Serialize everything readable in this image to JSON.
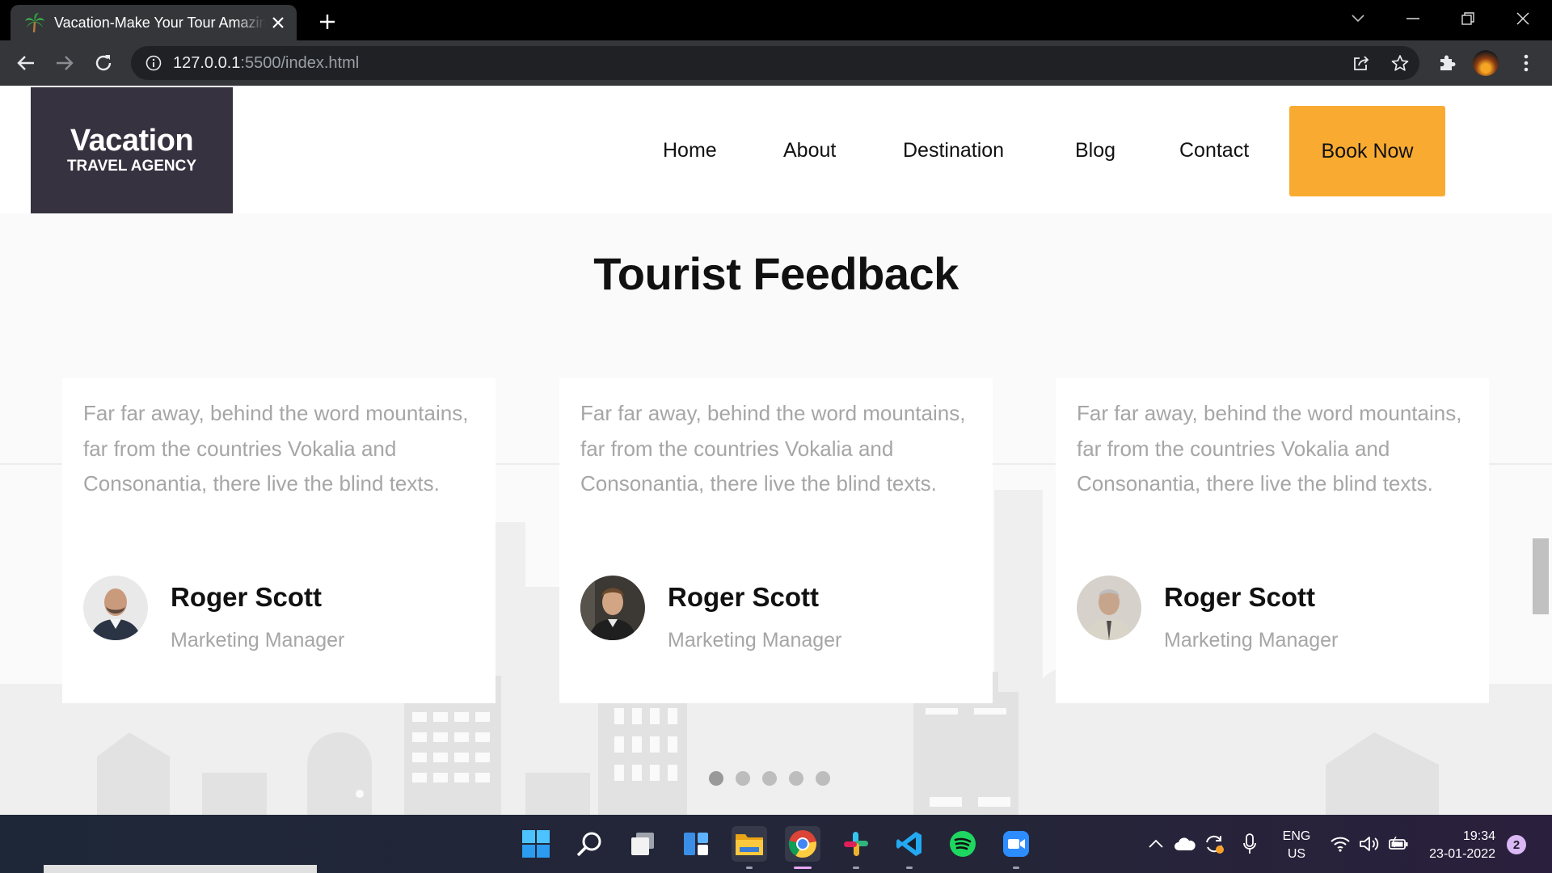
{
  "browser": {
    "tab_title": "Vacation-Make Your Tour Amazing",
    "url_host": "127.0.0.1",
    "url_path": ":5500/index.html"
  },
  "site": {
    "logo_title": "Vacation",
    "logo_subtitle": "TRAVEL AGENCY",
    "nav": [
      "Home",
      "About",
      "Destination",
      "Blog",
      "Contact"
    ],
    "cta_label": "Book Now",
    "cta_color": "#f9ab31",
    "logo_bg": "#36323f"
  },
  "feedback": {
    "heading": "Tourist Feedback",
    "cards": [
      {
        "text": "Far far away, behind the word mountains, far from the countries Vokalia and Consonantia, there live the blind texts.",
        "name": "Roger Scott",
        "role": "Marketing Manager"
      },
      {
        "text": "Far far away, behind the word mountains, far from the countries Vokalia and Consonantia, there live the blind texts.",
        "name": "Roger Scott",
        "role": "Marketing Manager"
      },
      {
        "text": "Far far away, behind the word mountains, far from the countries Vokalia and Consonantia, there live the blind texts.",
        "name": "Roger Scott",
        "role": "Marketing Manager"
      }
    ],
    "carousel_dot_count": 5,
    "carousel_active_index": 0
  },
  "taskbar": {
    "apps": [
      "windows-start-icon",
      "search-icon",
      "task-view-icon",
      "widgets-icon",
      "file-explorer-icon",
      "chrome-icon",
      "slack-icon",
      "vscode-icon",
      "spotify-icon",
      "zoom-icon"
    ],
    "lang_line1": "ENG",
    "lang_line2": "US",
    "time": "19:34",
    "date": "23-01-2022",
    "notification_count": "2"
  }
}
